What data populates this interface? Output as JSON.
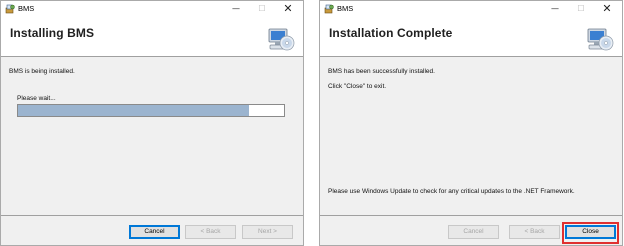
{
  "colors": {
    "progress_fill": "#9bb4cf",
    "highlight": "#e03030",
    "default_button_border": "#0078d7"
  },
  "left_window": {
    "title": "BMS",
    "controls": {
      "minimize": "—",
      "maximize": "☐",
      "close": "✕"
    },
    "banner_title": "Installing BMS",
    "status": "BMS is being installed.",
    "progress_label": "Please wait...",
    "progress_fraction": 0.87,
    "buttons": {
      "cancel": "Cancel",
      "back": "< Back",
      "next": "Next >"
    },
    "icons": {
      "app": "installer-app-icon",
      "banner": "computer-cd-icon"
    }
  },
  "right_window": {
    "title": "BMS",
    "controls": {
      "minimize": "—",
      "maximize": "☐",
      "close": "✕"
    },
    "banner_title": "Installation Complete",
    "line1": "BMS has been successfully installed.",
    "line2": "Click \"Close\" to exit.",
    "update_note": "Please use Windows Update to check for any critical updates to the .NET Framework.",
    "buttons": {
      "cancel": "Cancel",
      "back": "< Back",
      "close": "Close"
    },
    "icons": {
      "app": "installer-app-icon",
      "banner": "computer-cd-icon"
    }
  }
}
